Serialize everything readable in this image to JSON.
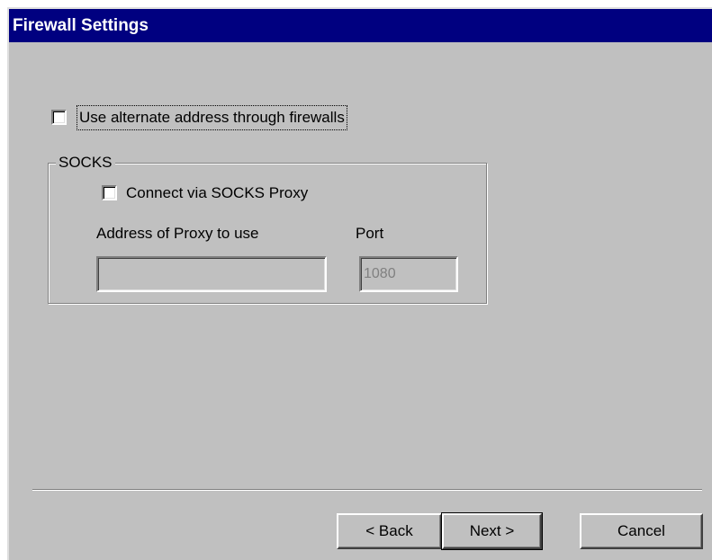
{
  "dialog": {
    "title": "Firewall Settings"
  },
  "alternate_address": {
    "label": "Use alternate address through firewalls",
    "checked": false
  },
  "socks": {
    "group_title": "SOCKS",
    "connect_label": "Connect via SOCKS Proxy",
    "connect_checked": false,
    "address_label": "Address of Proxy to use",
    "address_value": "",
    "port_label": "Port",
    "port_value": "1080"
  },
  "buttons": {
    "back": "< Back",
    "next": "Next >",
    "cancel": "Cancel"
  }
}
